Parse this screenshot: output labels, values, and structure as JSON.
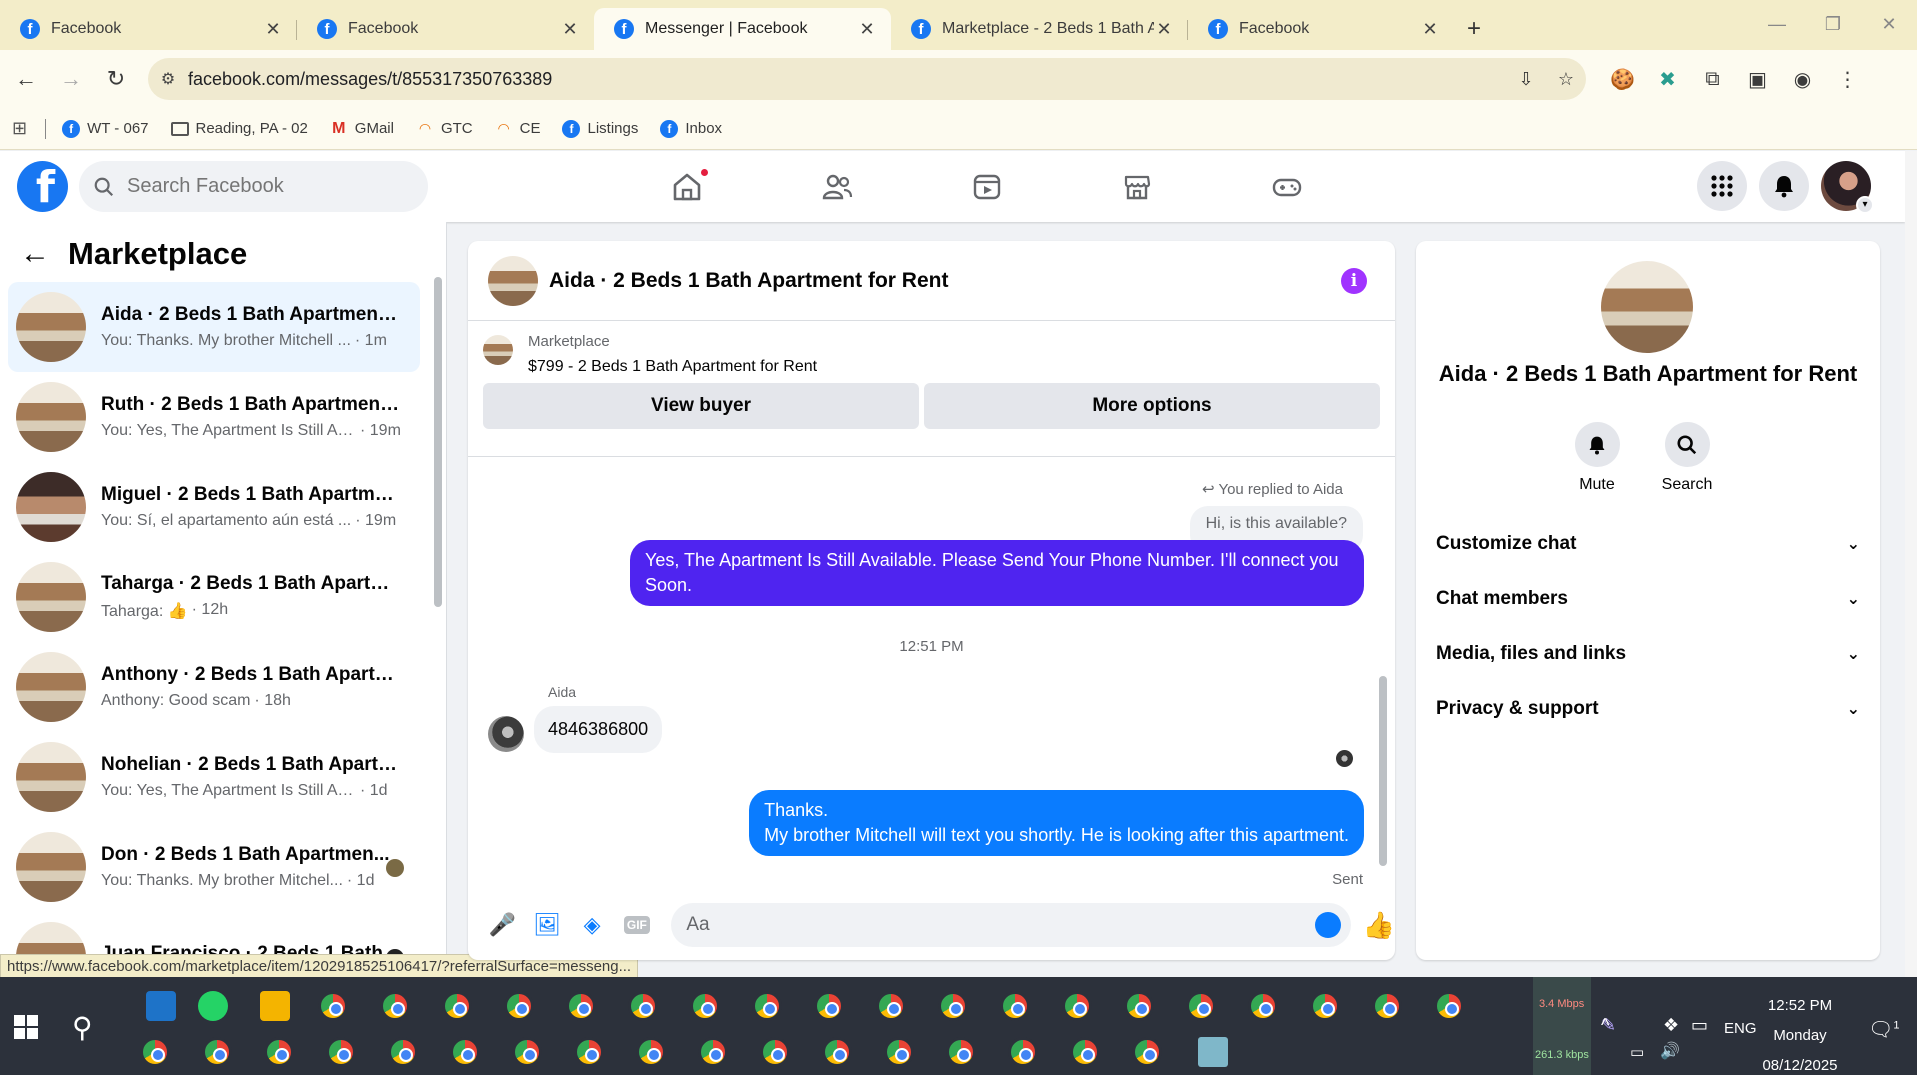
{
  "browser": {
    "tabs": [
      {
        "title": "Facebook",
        "active": false
      },
      {
        "title": "Facebook",
        "active": false
      },
      {
        "title": "Messenger | Facebook",
        "active": true
      },
      {
        "title": "Marketplace - 2 Beds 1 Bath Ap",
        "active": false
      },
      {
        "title": "Facebook",
        "active": false
      }
    ],
    "url": "facebook.com/messages/t/855317350763389",
    "bookmarks": [
      {
        "label": "WT - 067",
        "icon": "facebook-icon"
      },
      {
        "label": "Reading, PA - 02",
        "icon": "folder-icon"
      },
      {
        "label": "GMail",
        "icon": "gmail-icon"
      },
      {
        "label": "GTC",
        "icon": "rainbow-icon"
      },
      {
        "label": "CE",
        "icon": "rainbow-icon"
      },
      {
        "label": "Listings",
        "icon": "facebook-icon"
      },
      {
        "label": "Inbox",
        "icon": "facebook-icon"
      }
    ],
    "status_url": "https://www.facebook.com/marketplace/item/1202918525106417/?referralSurface=messeng..."
  },
  "fb": {
    "search_placeholder": "Search Facebook",
    "brand_color": "#1877f2"
  },
  "left": {
    "title": "Marketplace",
    "conversations": [
      {
        "name": "Aida · 2 Beds 1 Bath Apartment f...",
        "preview": "You: Thanks. My brother Mitchell ...",
        "time": "· 1m",
        "selected": true
      },
      {
        "name": "Ruth · 2 Beds 1 Bath Apartment ...",
        "preview": "You: Yes, The Apartment Is Still Av...",
        "time": "· 19m",
        "selected": false
      },
      {
        "name": "Miguel · 2 Beds 1 Bath Apartme...",
        "preview": "You: Sí, el apartamento aún está ...",
        "time": "· 19m",
        "selected": false
      },
      {
        "name": "Taharga · 2 Beds 1 Bath Apartme...",
        "preview": "Taharga: 👍",
        "time": "· 12h",
        "selected": false
      },
      {
        "name": "Anthony · 2 Beds 1 Bath Apartm...",
        "preview": "Anthony: Good scam",
        "time": "· 18h",
        "selected": false
      },
      {
        "name": "Nohelian · 2 Beds 1 Bath Apartm...",
        "preview": "You: Yes, The Apartment Is Still Avai...",
        "time": "· 1d",
        "selected": false
      },
      {
        "name": "Don · 2 Beds 1 Bath Apartmen...",
        "preview": "You: Thanks. My brother Mitchel...",
        "time": "· 1d",
        "selected": false
      },
      {
        "name": "Juan Francisco · 2 Beds 1 Bath...",
        "preview": "",
        "time": "",
        "selected": false
      }
    ]
  },
  "chat": {
    "title": "Aida · 2 Beds 1 Bath Apartment for Rent",
    "marketplace_label": "Marketplace",
    "listing": "$799 - 2 Beds 1 Bath Apartment for Rent",
    "view_buyer": "View buyer",
    "more_options": "More options",
    "replied_note": "You replied to Aida",
    "quoted": "Hi, is this available?",
    "msg1": "Yes, The Apartment Is Still Available. Please Send Your Phone Number. I'll connect you Soon.",
    "timestamp": "12:51 PM",
    "sender": "Aida",
    "incoming": "4846386800",
    "msg2_line1": "Thanks.",
    "msg2_line2": "My brother Mitchell will text you shortly. He is looking after this apartment.",
    "status": "Sent",
    "composer_placeholder": "Aa",
    "accent": "#0a7cff",
    "bubble_color": "#4f24f0"
  },
  "right": {
    "name": "Aida · 2 Beds 1 Bath Apartment for Rent",
    "mute": "Mute",
    "search": "Search",
    "sections": [
      "Customize chat",
      "Chat members",
      "Media, files and links",
      "Privacy & support"
    ]
  },
  "taskbar": {
    "net_up": "3.4 Mbps",
    "net_down": "261.3 kbps",
    "lang": "ENG",
    "time": "12:52 PM",
    "day": "Monday",
    "date": "08/12/2025",
    "notifications": "1"
  }
}
